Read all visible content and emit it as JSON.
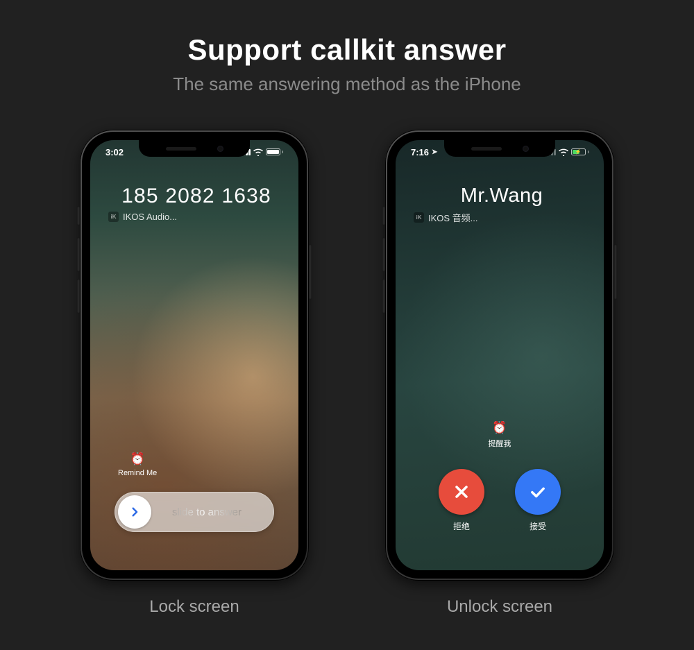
{
  "heading": {
    "title": "Support callkit answer",
    "subtitle": "The same answering method as the iPhone"
  },
  "phones": {
    "lock": {
      "caption": "Lock screen",
      "status_time": "3:02",
      "caller_name": "185 2082 1638",
      "caller_sub": "IKOS Audio...",
      "app_badge": "iK",
      "remind_label": "Remind Me",
      "remind_icon": "alarm-clock-icon",
      "slide_label": "slide to answer"
    },
    "unlock": {
      "caption": "Unlock screen",
      "status_time": "7:16",
      "caller_name": "Mr.Wang",
      "caller_sub": "IKOS 音频...",
      "app_badge": "iK",
      "remind_label": "提醒我",
      "remind_icon": "alarm-clock-icon",
      "decline_label": "拒绝",
      "accept_label": "接受"
    }
  }
}
